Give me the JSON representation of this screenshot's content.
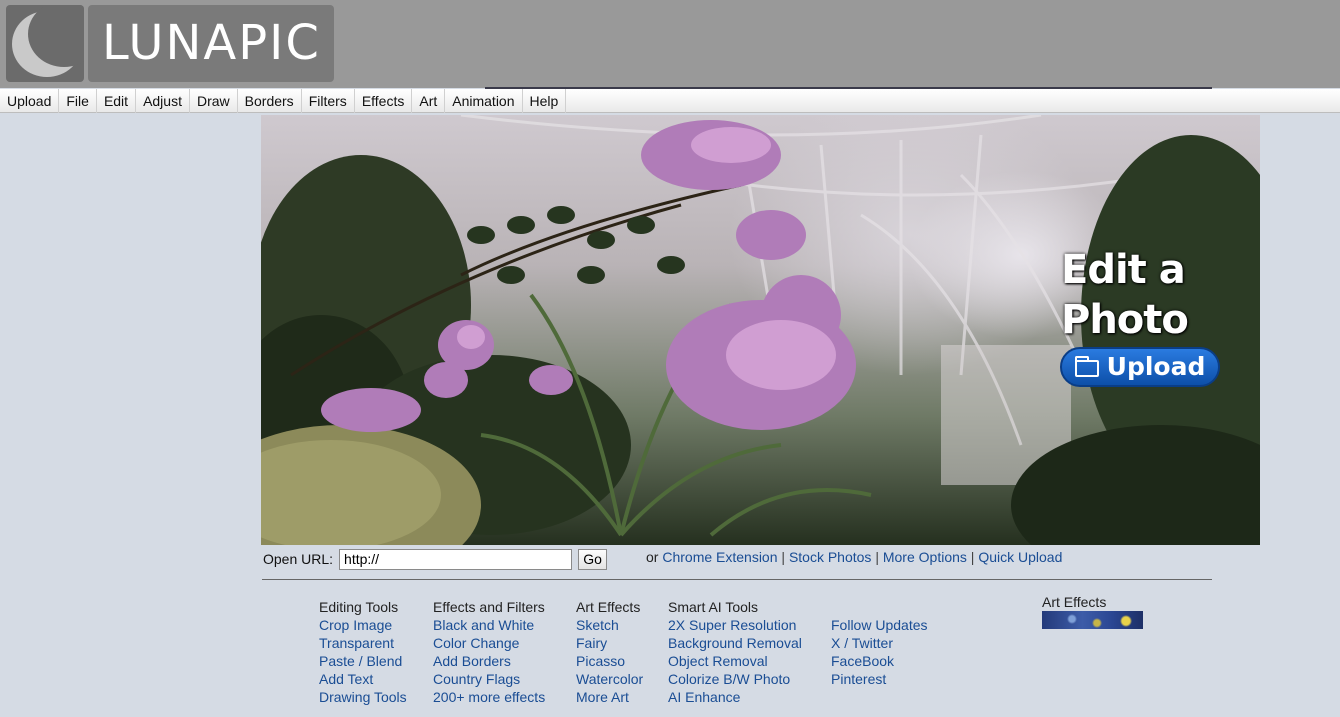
{
  "header": {
    "logo_text": "LUNAPIC"
  },
  "menu": [
    "Upload",
    "File",
    "Edit",
    "Adjust",
    "Draw",
    "Borders",
    "Filters",
    "Effects",
    "Art",
    "Animation",
    "Help"
  ],
  "hero": {
    "title": "Edit a Photo",
    "upload_label": "Upload"
  },
  "url": {
    "label": "Open URL:",
    "value": "http://",
    "go_label": "Go"
  },
  "links": {
    "prefix": "or",
    "items": [
      "Chrome Extension",
      "Stock Photos",
      "More Options",
      "Quick Upload"
    ],
    "separator": "|"
  },
  "columns": [
    {
      "heading": "Editing Tools",
      "items": [
        "Crop Image",
        "Transparent",
        "Paste / Blend",
        "Add Text",
        "Drawing Tools"
      ]
    },
    {
      "heading": "Effects and Filters",
      "items": [
        "Black and White",
        "Color Change",
        "Add Borders",
        "Country Flags",
        "200+ more effects"
      ]
    },
    {
      "heading": "Art Effects",
      "items": [
        "Sketch",
        "Fairy",
        "Picasso",
        "Watercolor",
        "More Art"
      ]
    },
    {
      "heading": "Smart AI Tools",
      "items": [
        "2X Super Resolution",
        "Background Removal",
        "Object Removal",
        "Colorize B/W Photo",
        "AI Enhance"
      ]
    },
    {
      "heading": "",
      "items": [
        "Follow Updates",
        "X / Twitter",
        "FaceBook",
        "Pinterest"
      ]
    }
  ],
  "art_box": {
    "label": "Art Effects"
  }
}
